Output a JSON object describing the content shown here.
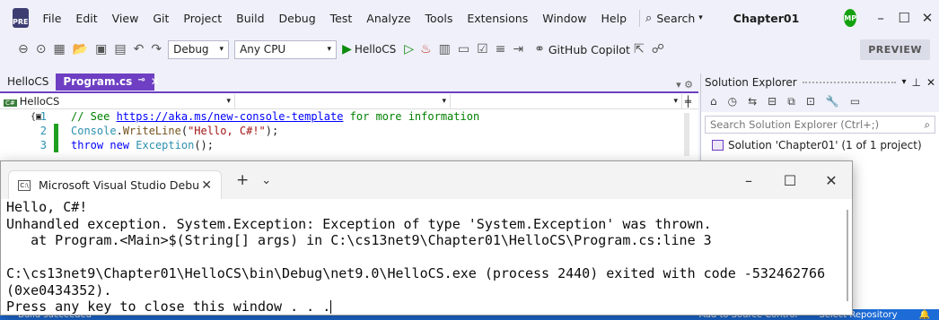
{
  "menubar": {
    "logo": "PRE",
    "items": [
      "File",
      "Edit",
      "View",
      "Git",
      "Project",
      "Build",
      "Debug",
      "Test",
      "Analyze",
      "Tools",
      "Extensions",
      "Window",
      "Help"
    ],
    "search_label": "Search",
    "solution_name": "Chapter01",
    "avatar_initials": "MP"
  },
  "toolbar": {
    "config": "Debug",
    "platform": "Any CPU",
    "run_target": "HelloCS",
    "copilot": "GitHub Copilot",
    "preview": "PREVIEW"
  },
  "doctabs": {
    "tabs": [
      {
        "label": "HelloCS",
        "active": false
      },
      {
        "label": "Program.cs",
        "active": true
      }
    ]
  },
  "editor": {
    "project_dropdown": "HelloCS",
    "lines": [
      {
        "number": "1",
        "comment_prefix": "// See ",
        "link": "https://aka.ms/new-console-template",
        "comment_suffix": " for more information"
      },
      {
        "number": "2",
        "type": "Console",
        "dot": ".",
        "method": "WriteLine",
        "open": "(",
        "string": "\"Hello, C#!\"",
        "close": ");"
      },
      {
        "number": "3",
        "kw1": "throw",
        "kw2": "new",
        "type": "Exception",
        "rest": "();"
      }
    ]
  },
  "solution_explorer": {
    "title": "Solution Explorer",
    "search_placeholder": "Search Solution Explorer (Ctrl+;)",
    "solution_label": "Solution 'Chapter01' (1 of 1 project)"
  },
  "console": {
    "tab_title": "Microsoft Visual Studio Debu",
    "output": [
      "Hello, C#!",
      "Unhandled exception. System.Exception: Exception of type 'System.Exception' was thrown.",
      "   at Program.<Main>$(String[] args) in C:\\cs13net9\\Chapter01\\HelloCS\\Program.cs:line 3",
      "",
      "C:\\cs13net9\\Chapter01\\HelloCS\\bin\\Debug\\net9.0\\HelloCS.exe (process 2440) exited with code -532462766",
      "(0xe0434352).",
      "Press any key to close this window . . ."
    ]
  },
  "statusbar": {
    "left": "Build succeeded",
    "source_control": "Add to Source Control",
    "repo": "Select Repository"
  },
  "colors": {
    "accent": "#6e3fc3",
    "status": "#1c6bd6",
    "run": "#0c8a0c"
  }
}
